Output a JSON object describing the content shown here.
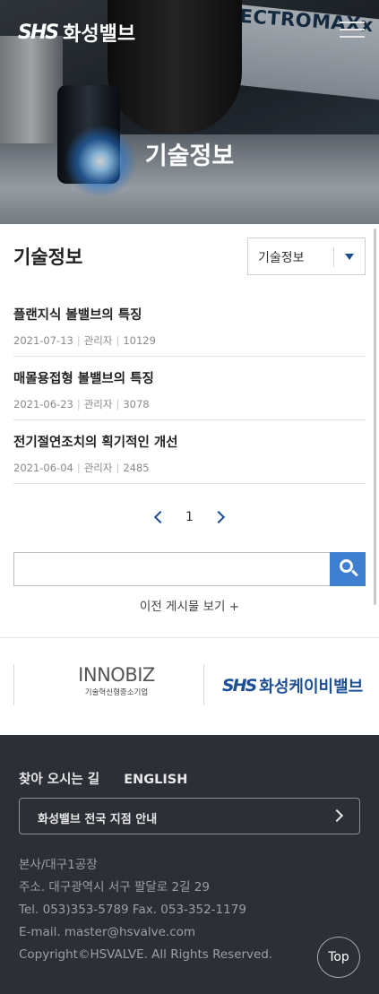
{
  "header": {
    "logo_mark": "SHS",
    "logo_text": "화성밸브",
    "hero_brand_text": "SPECTROMAXx",
    "hero_title": "기술정보"
  },
  "board": {
    "title": "기술정보",
    "category_select": "기술정보",
    "posts": [
      {
        "title": "플랜지식 볼밸브의 특징",
        "date": "2021-07-13",
        "author": "관리자",
        "views": "10129"
      },
      {
        "title": "매몰용접형 볼밸브의 특징",
        "date": "2021-06-23",
        "author": "관리자",
        "views": "3078"
      },
      {
        "title": "전기절연조치의 획기적인 개선",
        "date": "2021-06-04",
        "author": "관리자",
        "views": "2485"
      }
    ],
    "pagination": {
      "current": "1"
    },
    "search": {
      "value": "",
      "placeholder": ""
    },
    "prev_posts_link": "이전 게시물 보기 +"
  },
  "partners": {
    "innobiz_name": "INNOBIZ",
    "innobiz_sub": "기술혁신형중소기업",
    "company_mark": "SHS",
    "company_name": "화성케이비밸브"
  },
  "footer": {
    "link_directions": "찾아 오시는 길",
    "link_english": "ENGLISH",
    "branch_button": "화성밸브 전국 지점 안내",
    "info": {
      "office": "본사/대구1공장",
      "address": "주소. 대구광역시 서구 팔달로 2길 29",
      "phone": "Tel. 053)353-5789 Fax. 053-352-1179",
      "email": "E-mail. master@hsvalve.com",
      "copyright": "Copyright©HSVALVE. All Rights Reserved."
    },
    "top_button": "Top"
  },
  "colors": {
    "accent_blue": "#1c4f95",
    "search_button": "#3f7fd0",
    "footer_bg": "#2d2f37"
  }
}
